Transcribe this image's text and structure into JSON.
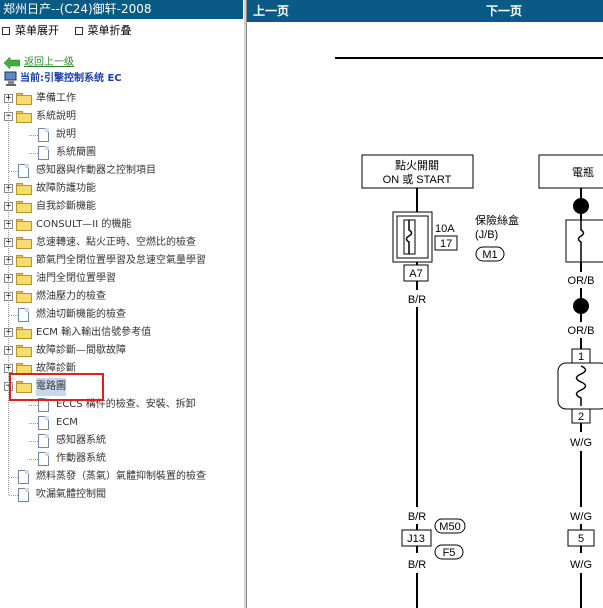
{
  "window": {
    "title": "郑州日产--(C24)御轩-2008"
  },
  "menu": {
    "expand_label": "菜单展开",
    "collapse_label": "菜单折叠"
  },
  "tree": {
    "back_label": "返回上一级",
    "current_label": "当前:引擎控制系统 EC",
    "items": [
      {
        "label": "準備工作",
        "type": "folder",
        "depth": 0,
        "state": "collapsed"
      },
      {
        "label": "系統說明",
        "type": "folder",
        "depth": 0,
        "state": "expanded"
      },
      {
        "label": "說明",
        "type": "doc",
        "depth": 1
      },
      {
        "label": "系統簡圖",
        "type": "doc",
        "depth": 1
      },
      {
        "label": "感知器與作動器之控制項目",
        "type": "doc",
        "depth": 0
      },
      {
        "label": "故障防護功能",
        "type": "folder",
        "depth": 0,
        "state": "collapsed"
      },
      {
        "label": "自我診斷機能",
        "type": "folder",
        "depth": 0,
        "state": "collapsed"
      },
      {
        "label": "CONSULT—II 的機能",
        "type": "folder",
        "depth": 0,
        "state": "collapsed"
      },
      {
        "label": "怠速轉速、點火正時、空燃比的檢查",
        "type": "folder",
        "depth": 0,
        "state": "collapsed"
      },
      {
        "label": "節氣門全閉位置學習及怠速空氣量學習",
        "type": "folder",
        "depth": 0,
        "state": "collapsed"
      },
      {
        "label": "油門全閉位置學習",
        "type": "folder",
        "depth": 0,
        "state": "collapsed"
      },
      {
        "label": "燃油壓力的檢查",
        "type": "folder",
        "depth": 0,
        "state": "collapsed"
      },
      {
        "label": "燃油切斷機能的檢查",
        "type": "doc",
        "depth": 0
      },
      {
        "label": "ECM 輸入輸出信號參考值",
        "type": "folder",
        "depth": 0,
        "state": "collapsed"
      },
      {
        "label": "故障診斷—間歇故障",
        "type": "folder",
        "depth": 0,
        "state": "collapsed"
      },
      {
        "label": "故障診斷",
        "type": "folder",
        "depth": 0,
        "state": "collapsed"
      },
      {
        "label": "電路圖",
        "type": "folder",
        "depth": 0,
        "state": "expanded",
        "selected": true
      },
      {
        "label": "ECCS 構件的檢查、安裝、拆卸",
        "type": "doc",
        "depth": 1
      },
      {
        "label": "ECM",
        "type": "doc",
        "depth": 1
      },
      {
        "label": "感知器系統",
        "type": "doc",
        "depth": 1
      },
      {
        "label": "作動器系統",
        "type": "doc",
        "depth": 1
      },
      {
        "label": "燃料蒸發（蒸氣）氣體抑制裝置的檢查",
        "type": "doc",
        "depth": 0
      },
      {
        "label": "吹漏氣體控制閥",
        "type": "doc",
        "depth": 0
      }
    ]
  },
  "nav": {
    "prev_label": "上一页",
    "next_label": "下一页"
  },
  "diagram": {
    "ignition_switch": [
      "點火開關",
      "ON 或 START"
    ],
    "battery": "電瓶",
    "fuse_amp": "10A",
    "fuse_no": "17",
    "fuse_box": [
      "保險絲盒",
      "(J/B)"
    ],
    "conn_m1": "M1",
    "conn_a7": "A7",
    "wire_br": "B/R",
    "wire_orb": "OR/B",
    "wire_wg": "W/G",
    "relay_pin1": "1",
    "relay_pin2": "2",
    "conn_m50": "M50",
    "conn_j13": "J13",
    "conn_f5": "F5",
    "conn_5": "5"
  },
  "colors": {
    "title_bar": "#0a5a86",
    "selection_box": "#e02020",
    "tree_text": "#333333",
    "link": "#1a3fb0"
  }
}
